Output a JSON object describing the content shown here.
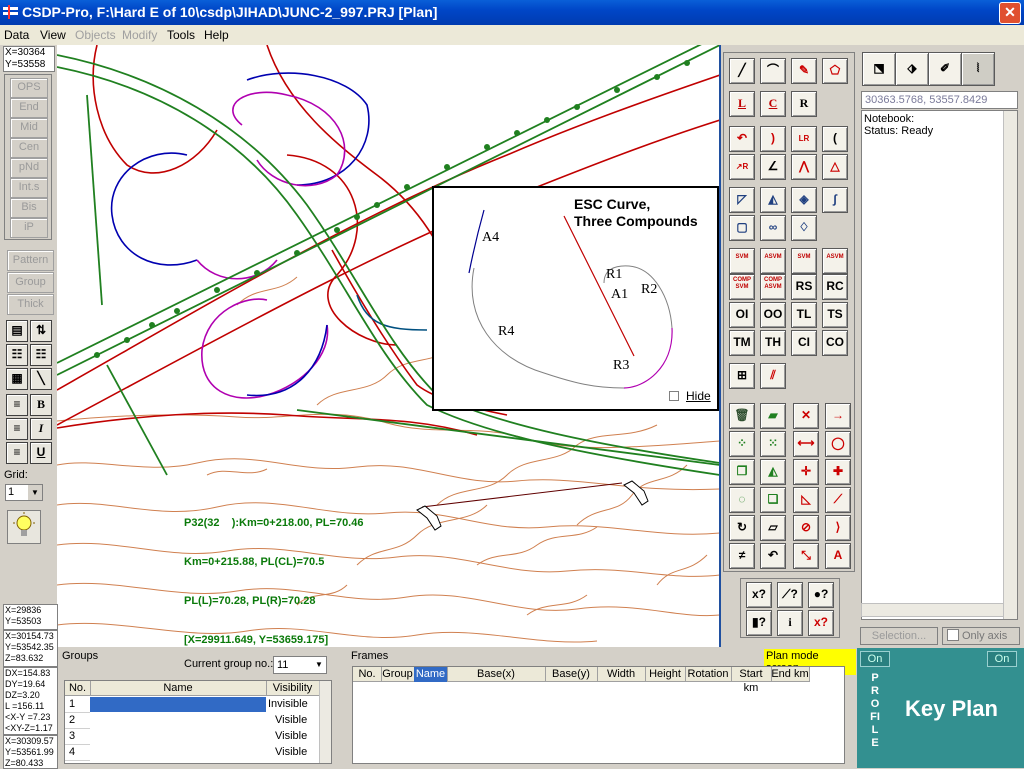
{
  "window": {
    "title": "CSDP-Pro, F:\\Hard E of 10\\csdp\\JIHAD\\JUNC-2_997.PRJ [Plan]"
  },
  "menu": [
    {
      "label": "Data",
      "enabled": true
    },
    {
      "label": "View",
      "enabled": true
    },
    {
      "label": "Objects",
      "enabled": false
    },
    {
      "label": "Modify",
      "enabled": false
    },
    {
      "label": "Tools",
      "enabled": true
    },
    {
      "label": "Help",
      "enabled": true
    }
  ],
  "cursor_coords_top": {
    "x": "X=30364",
    "y": "Y=53558"
  },
  "snap_buttons": [
    "OPS",
    "End",
    "Mid",
    "Cen",
    "pNd",
    "Int.s",
    "Bis",
    "iP"
  ],
  "group_buttons": [
    "Pattern",
    "Group",
    "Thick"
  ],
  "grid": {
    "label": "Grid:",
    "value": "1"
  },
  "canvas_label": {
    "line1": "P32(32    ):Km=0+218.00, PL=70.46",
    "line2": "Km=0+215.88, PL(CL)=70.5",
    "line3": "PL(L)=70.28, PL(R)=70.28",
    "line4": "[X=29911.649, Y=53659.175]"
  },
  "inset": {
    "title1": "ESC Curve,",
    "title2": "Three Compounds",
    "labels": {
      "a4": "A4",
      "r1": "R1",
      "a1": "A1",
      "r2": "R2",
      "r4": "R4",
      "r3": "R3"
    },
    "hide_label": "Hide"
  },
  "tool_labels": {
    "l": "L",
    "c": "C",
    "r": "R",
    "rs": "RS",
    "rc": "RC",
    "oi": "OI",
    "oo": "OO",
    "tl": "TL",
    "ts": "TS",
    "tm": "TM",
    "th": "TH",
    "ci": "CI",
    "co": "CO",
    "svm": "SVM",
    "asvm": "ASVM",
    "comp": "COMP",
    "q": "?",
    "i": "i",
    "xq": "x?"
  },
  "right_panel": {
    "coords": "30363.5768, 53557.8429",
    "notebook_line1": "Notebook:",
    "notebook_line2": "Status: Ready",
    "selection_button": "Selection...",
    "only_axis_label": "Only axis"
  },
  "coords_bottom": {
    "a": {
      "x": "X=29836",
      "y": "Y=53503"
    },
    "b": {
      "x": "X=30154.73",
      "y": "Y=53542.35",
      "z": "Z=83.632"
    },
    "c": {
      "dx": "DX=154.83",
      "dy": "DY=19.64",
      "dz": "DZ=3.20",
      "l": "L =156.11",
      "xy": "<X-Y =7.23",
      "xyz": "<XY-Z=1.17"
    },
    "d": {
      "x": "X=30309.57",
      "y": "Y=53561.99",
      "z": "Z=80.433"
    }
  },
  "groups": {
    "title": "Groups",
    "current_label": "Current group no.:",
    "current_value": "11",
    "columns": [
      "No.",
      "Name",
      "Visibility"
    ],
    "rows": [
      {
        "no": "1",
        "name": "",
        "visibility": "Invisible"
      },
      {
        "no": "2",
        "name": "",
        "visibility": "Visible"
      },
      {
        "no": "3",
        "name": "",
        "visibility": "Visible"
      },
      {
        "no": "4",
        "name": "",
        "visibility": "Visible"
      }
    ]
  },
  "frames": {
    "title": "Frames",
    "mode_badge": "Plan mode screen",
    "columns": [
      "No.",
      "Group",
      "Name",
      "Base(x)",
      "Base(y)",
      "Width",
      "Height",
      "Rotation",
      "Start km",
      "End km"
    ]
  },
  "profile": {
    "on_label": "On",
    "text": "PROFILE"
  },
  "keyplan": {
    "on_label": "On",
    "title": "Key Plan"
  }
}
